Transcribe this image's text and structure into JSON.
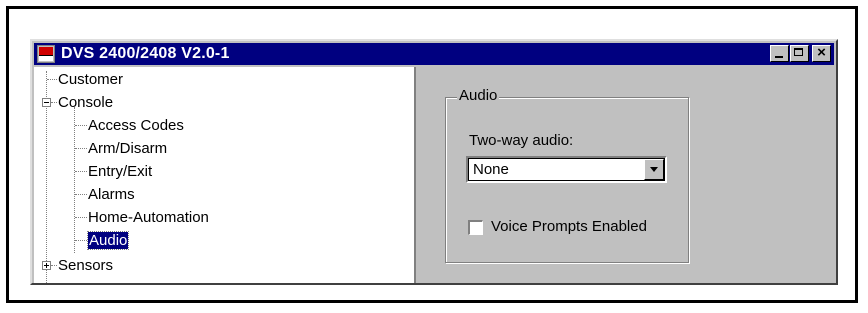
{
  "window": {
    "title": "DVS 2400/2408 V2.0-1",
    "title_bar_color": "#000080",
    "buttons": [
      "minimize",
      "maximize",
      "close"
    ],
    "close_label": "×"
  },
  "tree": {
    "items": [
      {
        "label": "Customer"
      },
      {
        "label": "Console",
        "expander": "minus"
      },
      {
        "label": "Access Codes"
      },
      {
        "label": "Arm/Disarm"
      },
      {
        "label": "Entry/Exit"
      },
      {
        "label": "Alarms"
      },
      {
        "label": "Home-Automation"
      },
      {
        "label": "Audio",
        "selected": true
      },
      {
        "label": "Sensors",
        "expander": "plus"
      }
    ]
  },
  "audio_panel": {
    "group_title": "Audio",
    "two_way_label": "Two-way audio:",
    "two_way_value": "None",
    "voice_prompts_label": "Voice Prompts Enabled",
    "voice_prompts_checked": false
  }
}
